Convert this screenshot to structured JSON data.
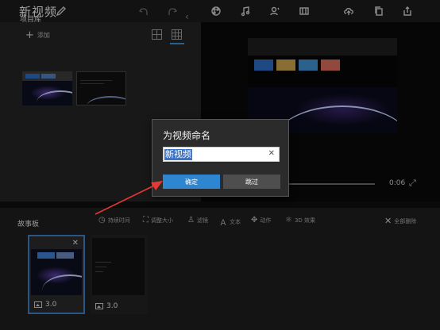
{
  "window": {
    "title": "新视频"
  },
  "library": {
    "title": "项目库",
    "add_label": "添加"
  },
  "preview": {
    "time": "0:06"
  },
  "storyboard": {
    "title": "故事板",
    "tools": [
      {
        "label": "持续时间",
        "icon": "clock-icon"
      },
      {
        "label": "调整大小",
        "icon": "resize-icon"
      },
      {
        "label": "滤镜",
        "icon": "filter-icon"
      },
      {
        "label": "文本",
        "icon": "text-icon"
      },
      {
        "label": "动作",
        "icon": "motion-icon"
      },
      {
        "label": "3D 效果",
        "icon": "3d-effects-icon"
      }
    ],
    "delete_all": "全部删除",
    "cards": [
      {
        "duration": "3.0"
      },
      {
        "duration": "3.0"
      }
    ]
  },
  "dialog": {
    "title": "为视频命名",
    "input_value": "新视频",
    "ok_label": "确定",
    "skip_label": "跳过"
  },
  "colors": {
    "accent": "#2f86d0",
    "annotation": "#e53935"
  }
}
